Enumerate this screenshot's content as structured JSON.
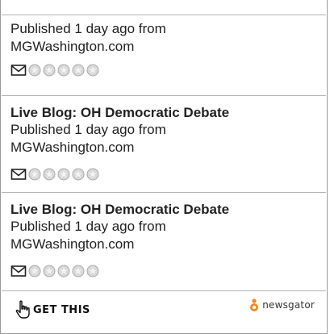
{
  "items": [
    {
      "title": "",
      "published": "Published 1 day ago from",
      "source": "MGWashington.com",
      "rating": 0
    },
    {
      "title": "Live Blog: OH Democratic Debate",
      "published": "Published 1 day ago from",
      "source": "MGWashington.com",
      "rating": 0
    },
    {
      "title": "Live Blog: OH Democratic Debate",
      "published": "Published 1 day ago from",
      "source": "MGWashington.com",
      "rating": 0
    }
  ],
  "icons": {
    "email": "envelope-icon",
    "star": "star-icon",
    "get_this": "hand-pointer-icon",
    "brand": "newsgator-logo"
  },
  "footer": {
    "get_this_label": "GET THIS",
    "brand_label": "newsgator"
  },
  "colors": {
    "border": "#9a9a9a",
    "separator": "#b5b5b5",
    "star_fill": "#d9d9d9",
    "brand_orange": "#f08a1c"
  }
}
